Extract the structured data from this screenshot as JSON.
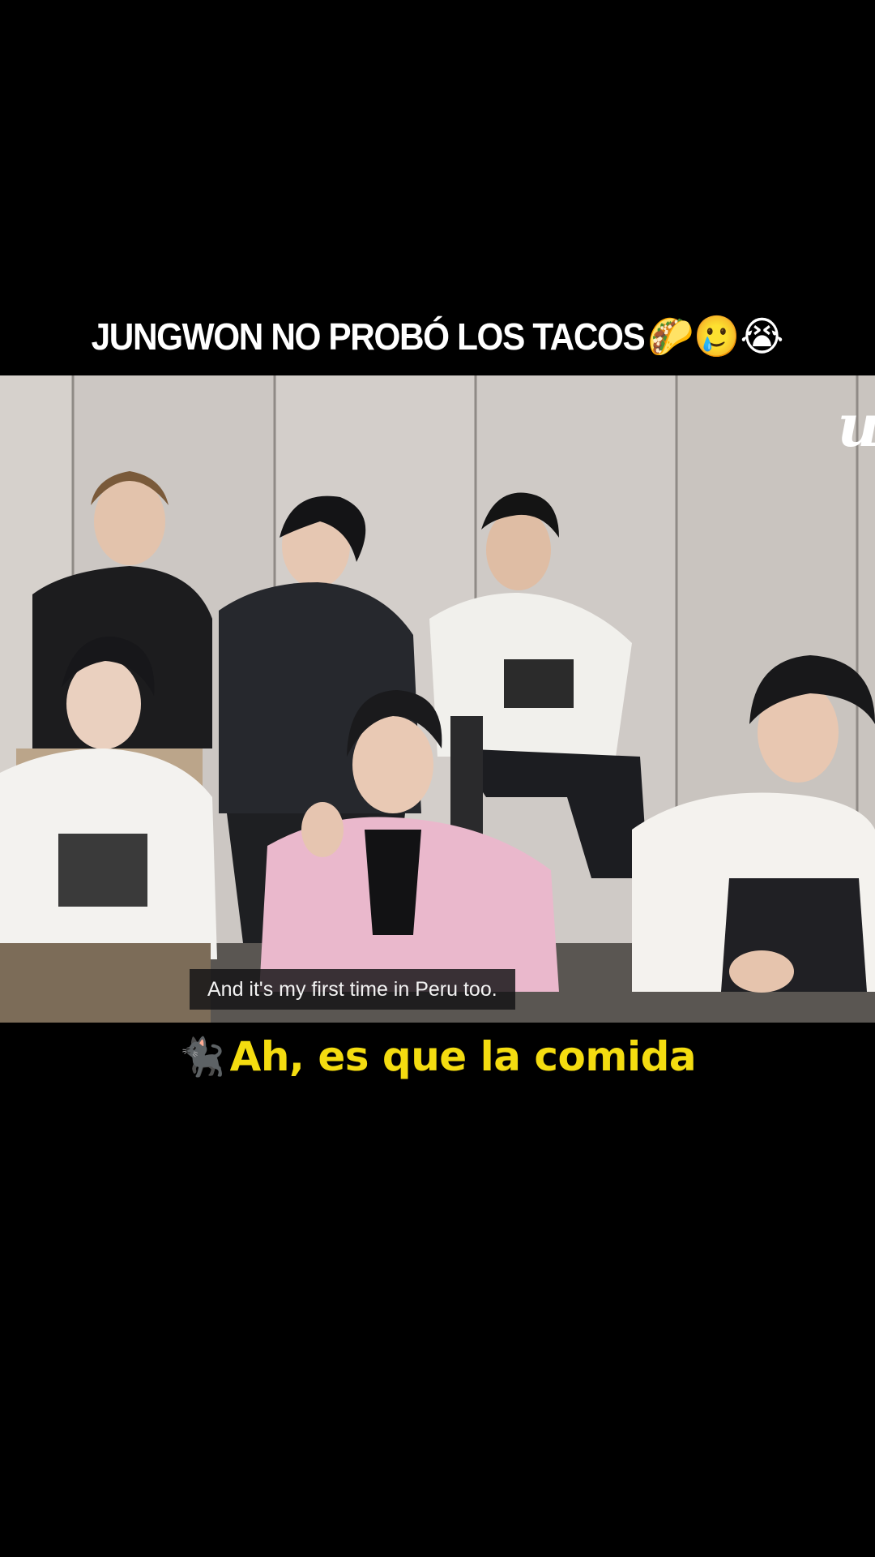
{
  "headline": {
    "text": "JUNGWON NO PROBÓ LOS TACOS",
    "emojis": "🌮🥲😭"
  },
  "video": {
    "watermark": "u",
    "closed_caption": "And it's my first time in Peru too."
  },
  "subtitle": {
    "icon": "🐈‍⬛",
    "text": "Ah, es que la comida"
  },
  "colors": {
    "background": "#000000",
    "headline_text": "#ffffff",
    "subtitle_text": "#f4dc10",
    "caption_box": "#121214"
  }
}
